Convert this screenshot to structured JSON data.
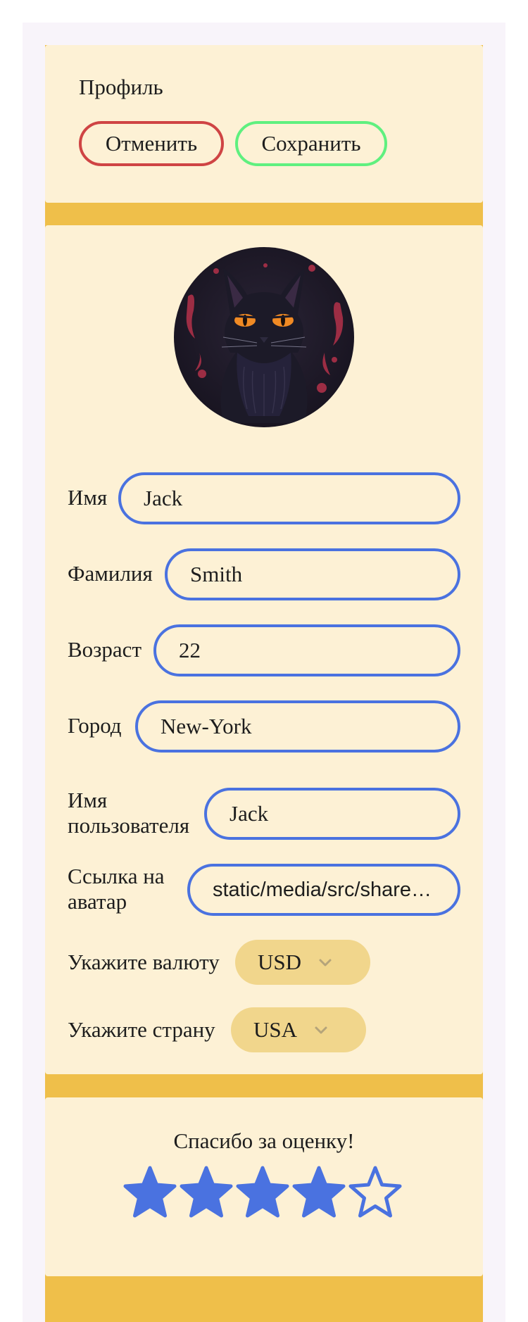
{
  "header": {
    "title": "Профиль",
    "cancel_label": "Отменить",
    "save_label": "Сохранить"
  },
  "form": {
    "fields": [
      {
        "label": "Имя",
        "value": "Jack"
      },
      {
        "label": "Фамилия",
        "value": "Smith"
      },
      {
        "label": "Возраст",
        "value": "22"
      },
      {
        "label": "Город",
        "value": "New-York"
      },
      {
        "label": "Имя пользователя",
        "value": "Jack"
      },
      {
        "label": "Ссылка на аватар",
        "value": "static/media/src/shared/assets/images/avatar.jpg"
      }
    ],
    "currency": {
      "label": "Укажите валюту",
      "value": "USD"
    },
    "country": {
      "label": "Укажите страну",
      "value": "USA"
    }
  },
  "rating": {
    "title": "Спасибо за оценку!",
    "value": 4,
    "max": 5
  },
  "colors": {
    "accent_blue": "#4a72e0",
    "cancel_red": "#cf4444",
    "save_green": "#5ff07f",
    "background_yellow": "#efbf4a",
    "card": "#fdf1d5",
    "select_fill": "#f1d68c"
  },
  "icons": {
    "avatar": "black-cat-avatar",
    "select_chevron": "chevron-down-icon",
    "star": "star-icon"
  }
}
